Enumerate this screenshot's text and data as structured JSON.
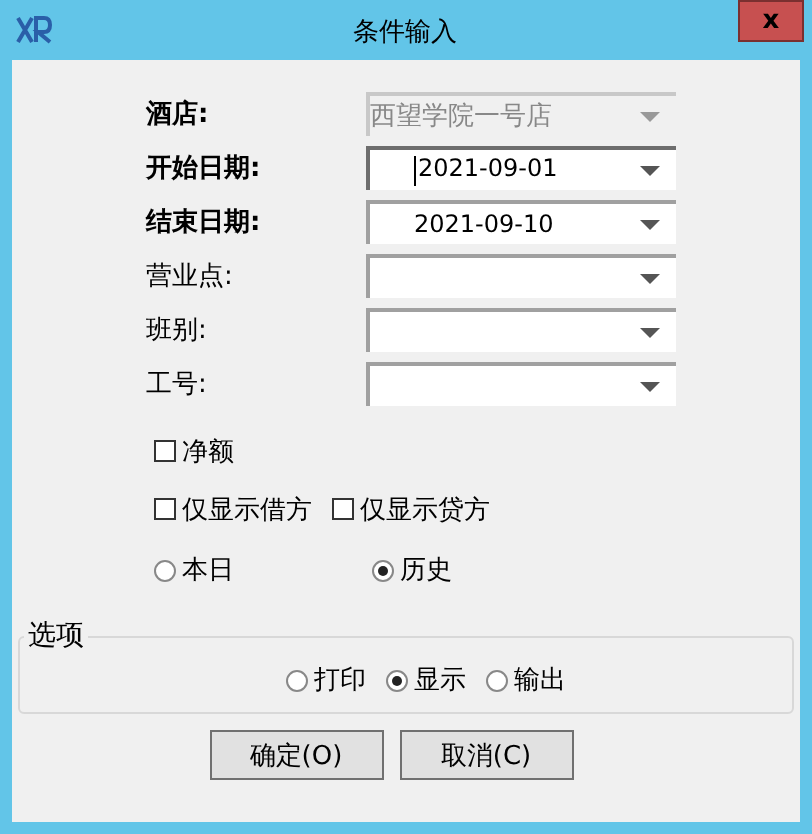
{
  "window": {
    "title": "条件输入",
    "close": "x"
  },
  "fields": [
    {
      "label": "酒店:",
      "value": "西望学院一号店",
      "bold": true,
      "disabled": true,
      "focused": false
    },
    {
      "label": "开始日期:",
      "value": "2021-09-01",
      "bold": true,
      "disabled": false,
      "focused": true
    },
    {
      "label": "结束日期:",
      "value": "2021-09-10",
      "bold": true,
      "disabled": false,
      "focused": false
    },
    {
      "label": "营业点:",
      "bold": false,
      "disabled": false,
      "focused": false
    },
    {
      "label": "班别:",
      "bold": false,
      "disabled": false,
      "focused": false
    },
    {
      "label": "工号:",
      "bold": false,
      "disabled": false,
      "focused": false
    }
  ],
  "checkbox_rows": [
    [
      {
        "label": "净额",
        "checked": false
      }
    ],
    [
      {
        "label": "仅显示借方",
        "checked": false
      },
      {
        "label": "仅显示贷方",
        "checked": false
      }
    ]
  ],
  "range": [
    {
      "label": "本日",
      "selected": false
    },
    {
      "label": "历史",
      "selected": true
    }
  ],
  "options": {
    "title": "选项",
    "items": [
      {
        "label": "打印",
        "selected": false
      },
      {
        "label": "显示",
        "selected": true
      },
      {
        "label": "输出",
        "selected": false
      }
    ]
  },
  "buttons": [
    "确定(O)",
    "取消(C)"
  ]
}
